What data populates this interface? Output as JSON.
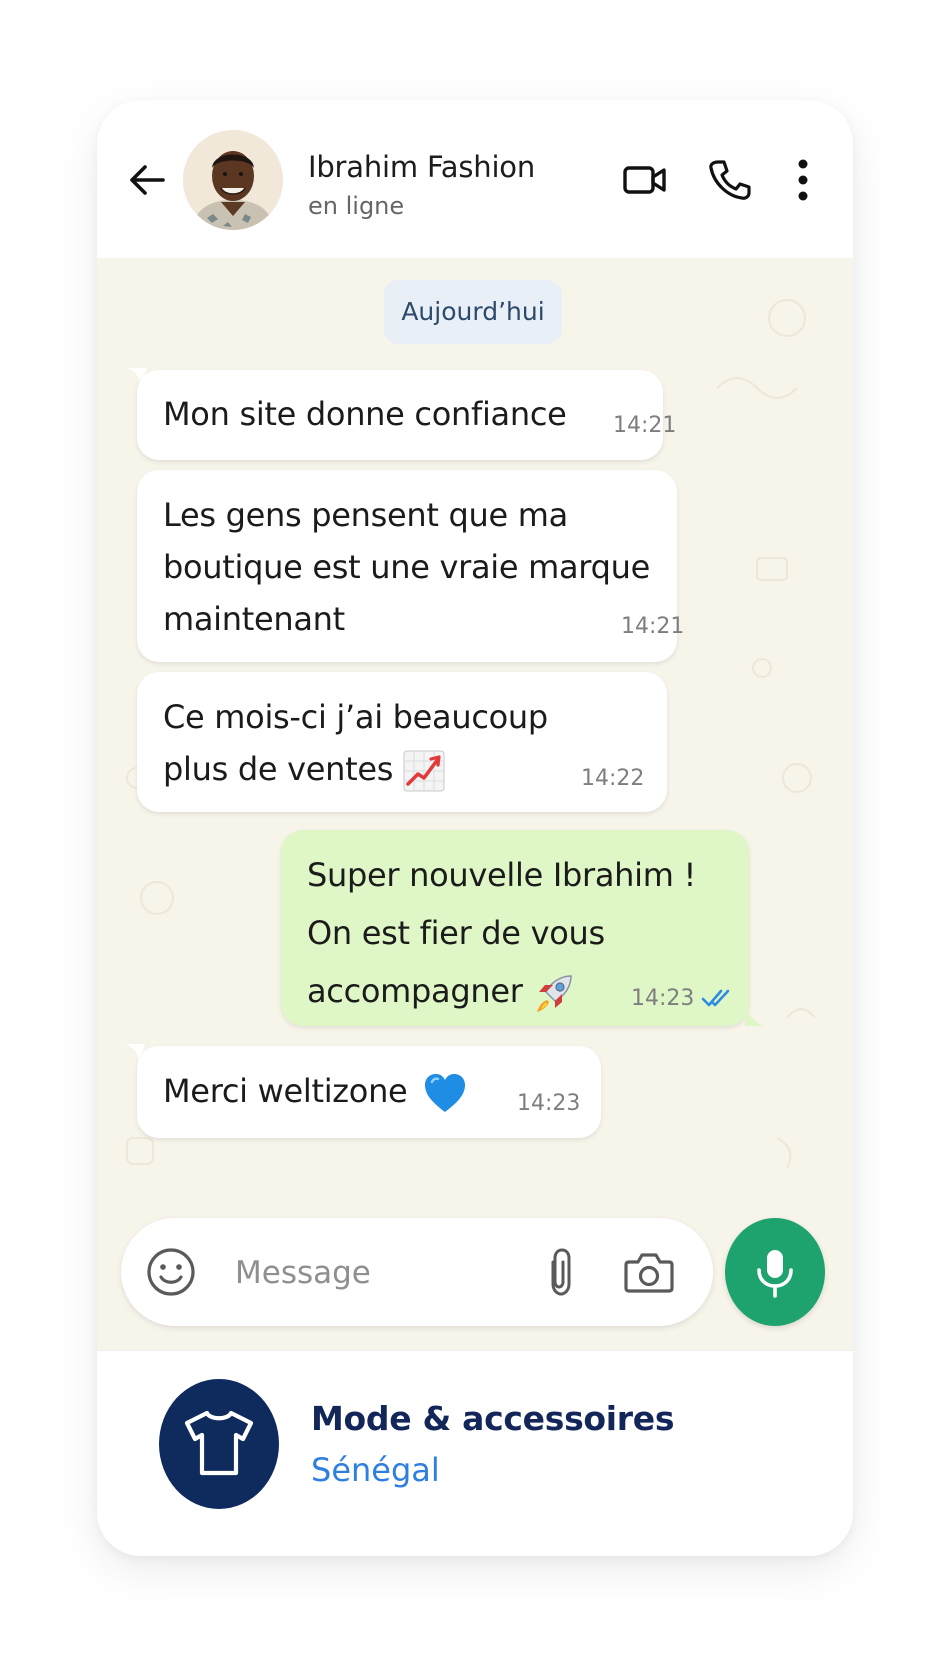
{
  "header": {
    "contact_name": "Ibrahim Fashion",
    "contact_status": "en ligne"
  },
  "chat": {
    "date_label": "Aujourd’hui",
    "messages": [
      {
        "direction": "incoming",
        "lines": [
          "Mon site donne confiance"
        ],
        "time": "14:21"
      },
      {
        "direction": "incoming",
        "lines": [
          "Les gens pensent que ma",
          "boutique est une vraie marque",
          "maintenant"
        ],
        "time": "14:21"
      },
      {
        "direction": "incoming",
        "lines": [
          "Ce mois-ci j’ai beaucoup",
          "plus de ventes"
        ],
        "emoji": "chart-increasing-icon",
        "time": "14:22"
      },
      {
        "direction": "outgoing",
        "lines": [
          "Super nouvelle Ibrahim !",
          "On est fier de vous",
          "accompagner"
        ],
        "emoji": "rocket-icon",
        "time": "14:23",
        "status": "read"
      },
      {
        "direction": "incoming",
        "lines": [
          "Merci weltizone"
        ],
        "emoji": "blue-heart-icon",
        "time": "14:23"
      }
    ]
  },
  "composer": {
    "placeholder": "Message"
  },
  "footer": {
    "category": "Mode & accessoires",
    "country": "Sénégal",
    "icon": "tshirt-icon"
  },
  "colors": {
    "chat_background": "#f7f4ea",
    "outgoing_bubble": "#dff7c6",
    "mic_button": "#1fa36e",
    "badge": "#0f2a5c",
    "country_text": "#2f7fe0",
    "read_ticks": "#2d8be0"
  }
}
